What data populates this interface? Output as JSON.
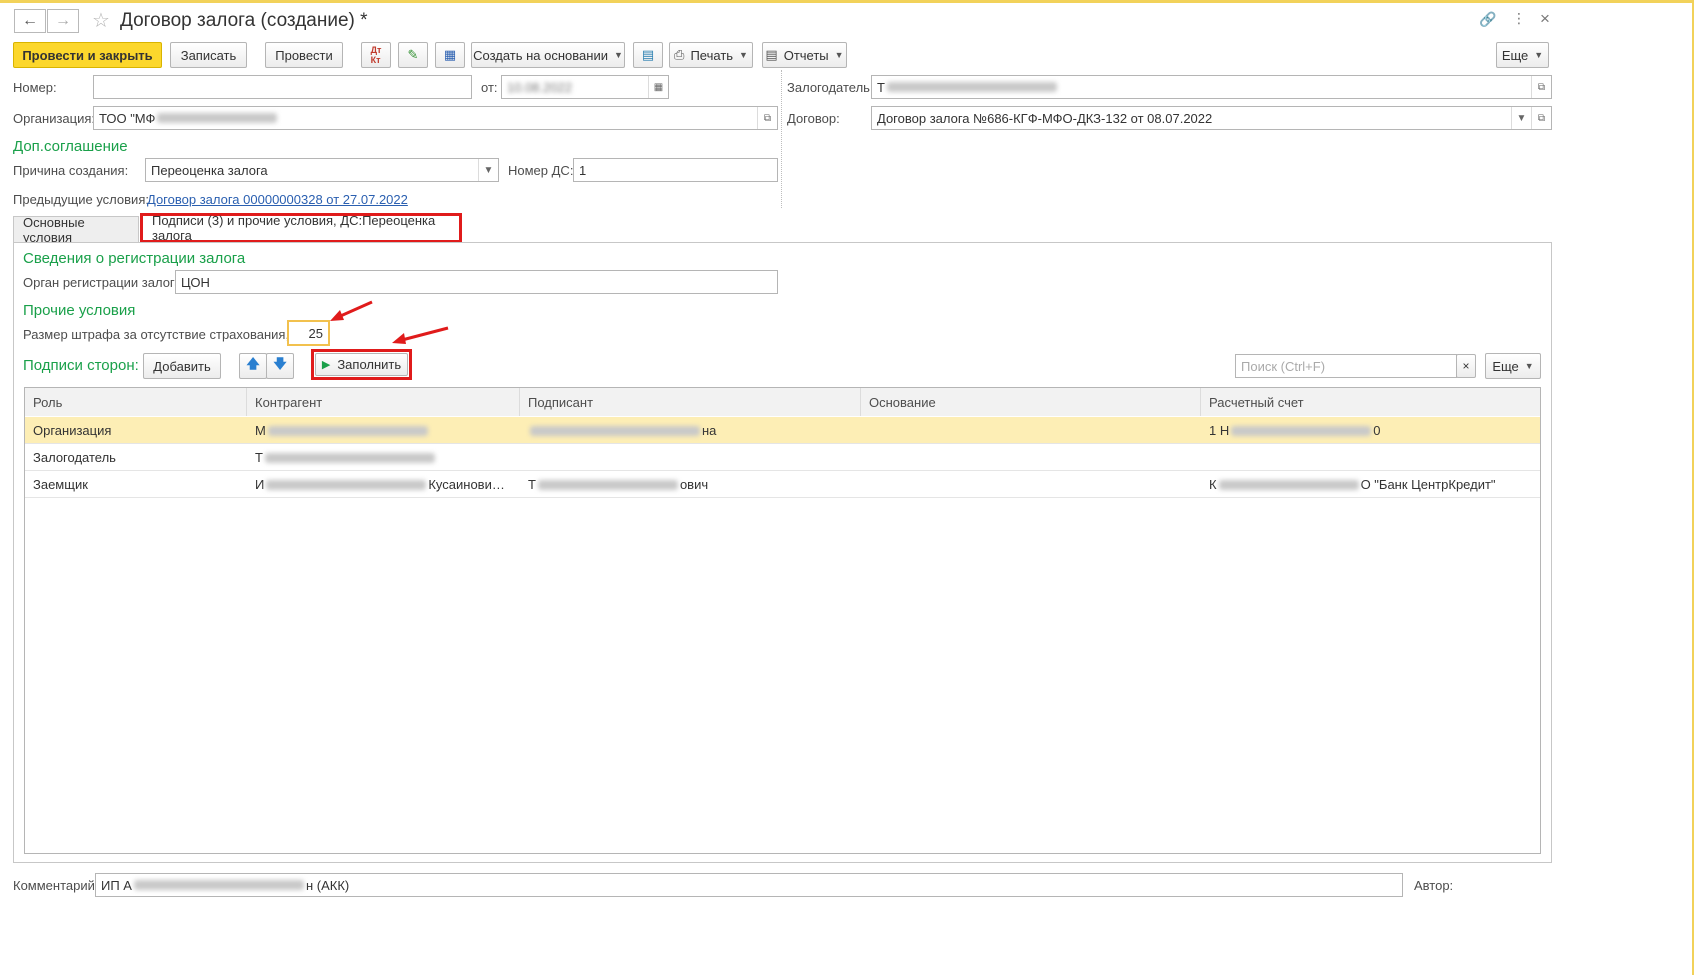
{
  "window": {
    "title": "Договор залога (создание) *",
    "modified_marker": "*"
  },
  "toolbar": {
    "post_close": "Провести и закрыть",
    "save": "Записать",
    "post": "Провести",
    "create_based": "Создать на основании",
    "print": "Печать",
    "reports": "Отчеты",
    "more": "Еще"
  },
  "header": {
    "number_label": "Номер:",
    "number_value": "",
    "date_label": "от:",
    "date_value": "10.08.2022",
    "org_label": "Организация:",
    "org_value_prefix": "ТОО \"МФ",
    "pledger_label": "Залогодатель:",
    "pledger_value_prefix": "Т",
    "contract_label": "Договор:",
    "contract_value": "Договор залога №686-КГФ-МФО-ДКЗ-132 от 08.07.2022"
  },
  "addendum": {
    "section_title": "Доп.соглашение",
    "reason_label": "Причина создания:",
    "reason_value": "Переоценка залога",
    "ds_number_label": "Номер ДС:",
    "ds_number_value": "1",
    "prev_conditions_label": "Предыдущие условия:",
    "prev_conditions_link": "Договор залога 00000000328 от 27.07.2022"
  },
  "tabs": [
    {
      "label": "Основные условия",
      "active": false
    },
    {
      "label": "Подписи (3) и прочие условия, ДС:Переоценка залога",
      "active": true
    }
  ],
  "registration": {
    "section_title": "Сведения о регистрации залога",
    "organ_label": "Орган регистрации залога:",
    "organ_value": "ЦОН"
  },
  "other_conditions": {
    "section_title": "Прочие условия",
    "penalty_label": "Размер штрафа за отсутствие страхования, %:",
    "penalty_value": "25"
  },
  "signatures": {
    "section_title": "Подписи сторон:",
    "add_button": "Добавить",
    "fill_button": "Заполнить",
    "search_placeholder": "Поиск (Ctrl+F)",
    "more_button": "Еще",
    "columns": [
      "Роль",
      "Контрагент",
      "Подписант",
      "Основание",
      "Расчетный счет"
    ],
    "rows": [
      {
        "role": "Организация",
        "counterparty_prefix": "М",
        "counterparty_suffix": "",
        "signer_prefix": "",
        "signer_suffix": "на",
        "basis": "",
        "account_prefix": "1 Н",
        "account_suffix": "0"
      },
      {
        "role": "Залогодатель",
        "counterparty_prefix": "Т",
        "counterparty_suffix": "",
        "signer_prefix": "",
        "signer_suffix": "",
        "basis": "",
        "account_prefix": "",
        "account_suffix": ""
      },
      {
        "role": "Заемщик",
        "counterparty_prefix": "И",
        "counterparty_suffix": "Кусаинови…",
        "signer_prefix": "Т",
        "signer_suffix": "ович",
        "basis": "",
        "account_prefix": "К",
        "account_suffix": "О \"Банк ЦентрКредит\""
      }
    ]
  },
  "footer": {
    "comment_label": "Комментарий:",
    "comment_prefix": "ИП А",
    "comment_suffix": "н (АКК)",
    "author_label": "Автор:"
  },
  "colors": {
    "primary_button": "#fcd72c",
    "section_green": "#1aa04a",
    "highlight_red": "#e01b1b",
    "selected_row": "#fdeeb5",
    "link_blue": "#2a5fb0"
  }
}
